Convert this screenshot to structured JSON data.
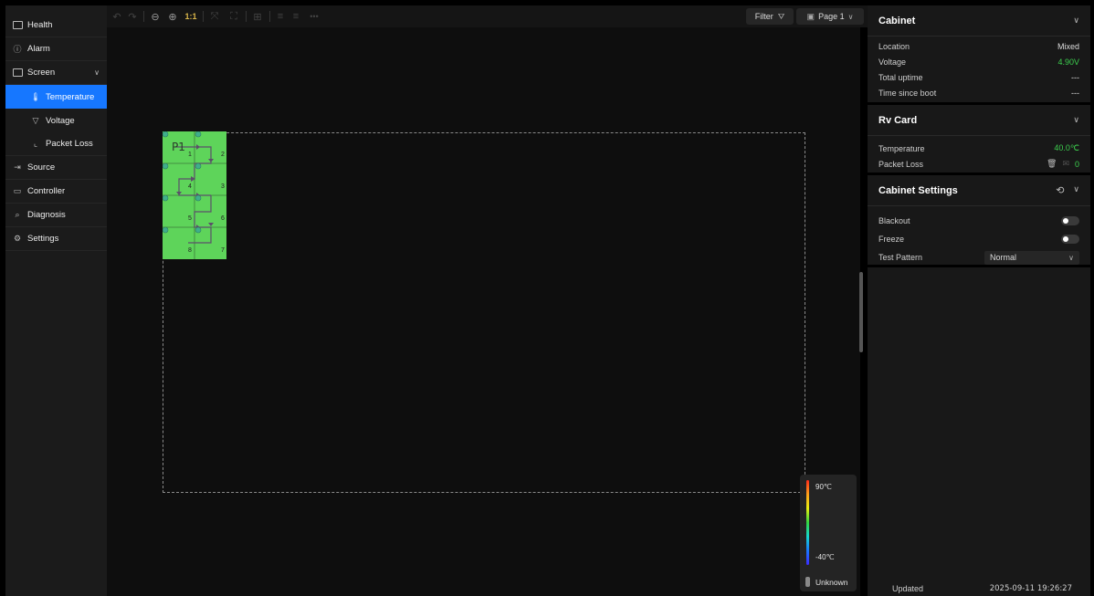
{
  "sidebar": {
    "items": [
      {
        "label": "Health",
        "icon": "health-icon"
      },
      {
        "label": "Alarm",
        "icon": "alarm-icon"
      },
      {
        "label": "Screen",
        "icon": "screen-icon"
      },
      {
        "label": "Temperature",
        "icon": "thermometer-icon"
      },
      {
        "label": "Voltage",
        "icon": "voltage-icon"
      },
      {
        "label": "Packet Loss",
        "icon": "chart-icon"
      },
      {
        "label": "Source",
        "icon": "source-icon"
      },
      {
        "label": "Controller",
        "icon": "controller-icon"
      },
      {
        "label": "Diagnosis",
        "icon": "diagnosis-icon"
      },
      {
        "label": "Settings",
        "icon": "settings-icon"
      }
    ],
    "active": "Temperature"
  },
  "toolbar": {
    "zoom_reset": "1:1",
    "filter_label": "Filter",
    "page_label": "Page 1",
    "more": "•••"
  },
  "canvas": {
    "module": {
      "label": "P1",
      "ports": [
        "1",
        "2",
        "3",
        "4",
        "5",
        "6",
        "7",
        "8"
      ],
      "fill_color": "#5ed45a"
    }
  },
  "legend": {
    "max": "90℃",
    "min": "-40℃",
    "unknown": "Unknown"
  },
  "cabinet": {
    "title": "Cabinet",
    "rows": [
      {
        "label": "Location",
        "value": "Mixed"
      },
      {
        "label": "Voltage",
        "value": "4.90V"
      },
      {
        "label": "Total uptime",
        "value": "---"
      },
      {
        "label": "Time since boot",
        "value": "---"
      }
    ]
  },
  "rv_card": {
    "title": "Rv Card",
    "temperature_label": "Temperature",
    "temperature_value": "40.0℃",
    "packet_loss_label": "Packet Loss",
    "packet_loss_value": "0"
  },
  "cabinet_settings": {
    "title": "Cabinet Settings",
    "blackout_label": "Blackout",
    "freeze_label": "Freeze",
    "test_pattern_label": "Test Pattern",
    "test_pattern_value": "Normal"
  },
  "footer": {
    "updated_label": "Updated",
    "updated_value": "2025-09-11 19:26:27"
  },
  "colors": {
    "accent": "#1677ff",
    "ok_green": "#3ccf4e",
    "module_green": "#5ed45a"
  }
}
